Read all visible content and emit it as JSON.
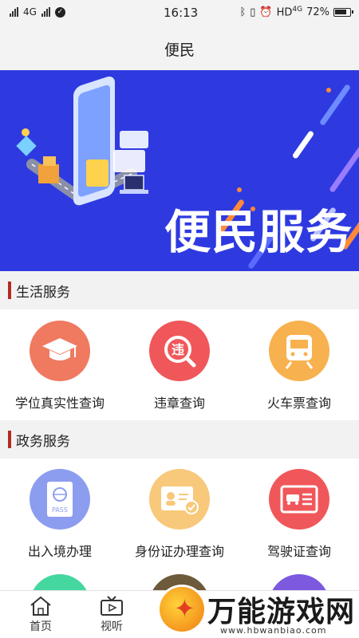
{
  "status_bar": {
    "network": "4G",
    "time": "16:13",
    "right_network": "HD",
    "right_network_sup": "4G",
    "battery": "72%"
  },
  "nav": {
    "title": "便民"
  },
  "banner": {
    "title": "便民服务"
  },
  "sections": [
    {
      "title": "生活服务",
      "items": [
        {
          "label": "学位真实性查询",
          "icon": "graduation-cap-icon",
          "color": "#ef7a5f"
        },
        {
          "label": "违章查询",
          "icon": "violation-search-icon",
          "color": "#f0575a"
        },
        {
          "label": "火车票查询",
          "icon": "train-icon",
          "color": "#f8b14f"
        }
      ]
    },
    {
      "title": "政务服务",
      "items": [
        {
          "label": "出入境办理",
          "icon": "passport-icon",
          "color": "#8c9df0"
        },
        {
          "label": "身份证办理查询",
          "icon": "id-card-icon",
          "color": "#f8c97a"
        },
        {
          "label": "驾驶证查询",
          "icon": "driver-license-icon",
          "color": "#f0575a"
        }
      ]
    }
  ],
  "row3_colors": [
    "#45d7a0",
    "#6d5a3a",
    "#7d59e0"
  ],
  "tabs": [
    {
      "label": "首页",
      "icon": "home-icon"
    },
    {
      "label": "视听",
      "icon": "tv-icon"
    }
  ],
  "watermark": {
    "text": "万能游戏网",
    "url": "www.hbwanbiao.com"
  },
  "colors": {
    "accent_bar": "#b22a22",
    "banner_bg": "#2e3ae0"
  }
}
